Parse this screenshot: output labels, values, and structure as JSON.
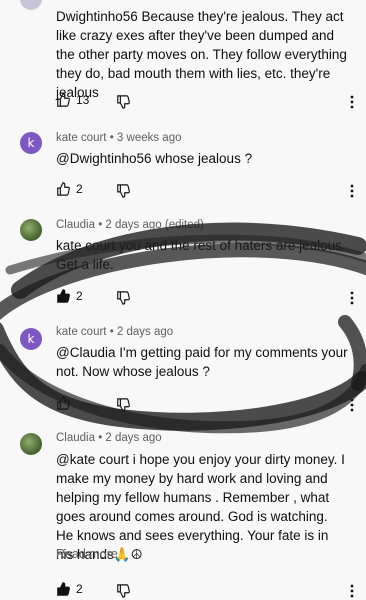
{
  "comments": [
    {
      "text": "Dwightinho56 Because they're jealous. They act like crazy exes after they've been dumped and the other party moves on. They follow everything they do, bad mouth them with lies, etc. they're jealous",
      "likes": "13"
    },
    {
      "avatar_letter": "k",
      "author": "kate court",
      "time": "• 3 weeks ago",
      "text": "@Dwightinho56 whose jealous ?",
      "likes": "2"
    },
    {
      "author": "Claudia",
      "time": "• 2 days ago (edited)",
      "text": "kate court  you and the rest of haters are jealous. Get a life.",
      "likes": "2"
    },
    {
      "avatar_letter": "k",
      "author": "kate court",
      "time": "• 2 days ago",
      "text": "@Claudia I'm getting paid for my comments your not. Now whose jealous  ?"
    },
    {
      "author": "Claudia",
      "time": "• 2 days ago",
      "text": "@kate court   i hope you enjoy your dirty money. I make my money by hard work and loving and helping my fellow humans . Remember , what goes around comes around.  God is watching. He knows and sees everything. Your fate is in his hands🙏☮",
      "read_more": "Read more",
      "likes": "2"
    }
  ],
  "icons": [
    "like-icon",
    "dislike-icon",
    "more-vert-icon"
  ],
  "colors": {
    "avatar_k": "#7e57c2",
    "meta_text": "#606060",
    "scribble": "#1a1a1a"
  }
}
